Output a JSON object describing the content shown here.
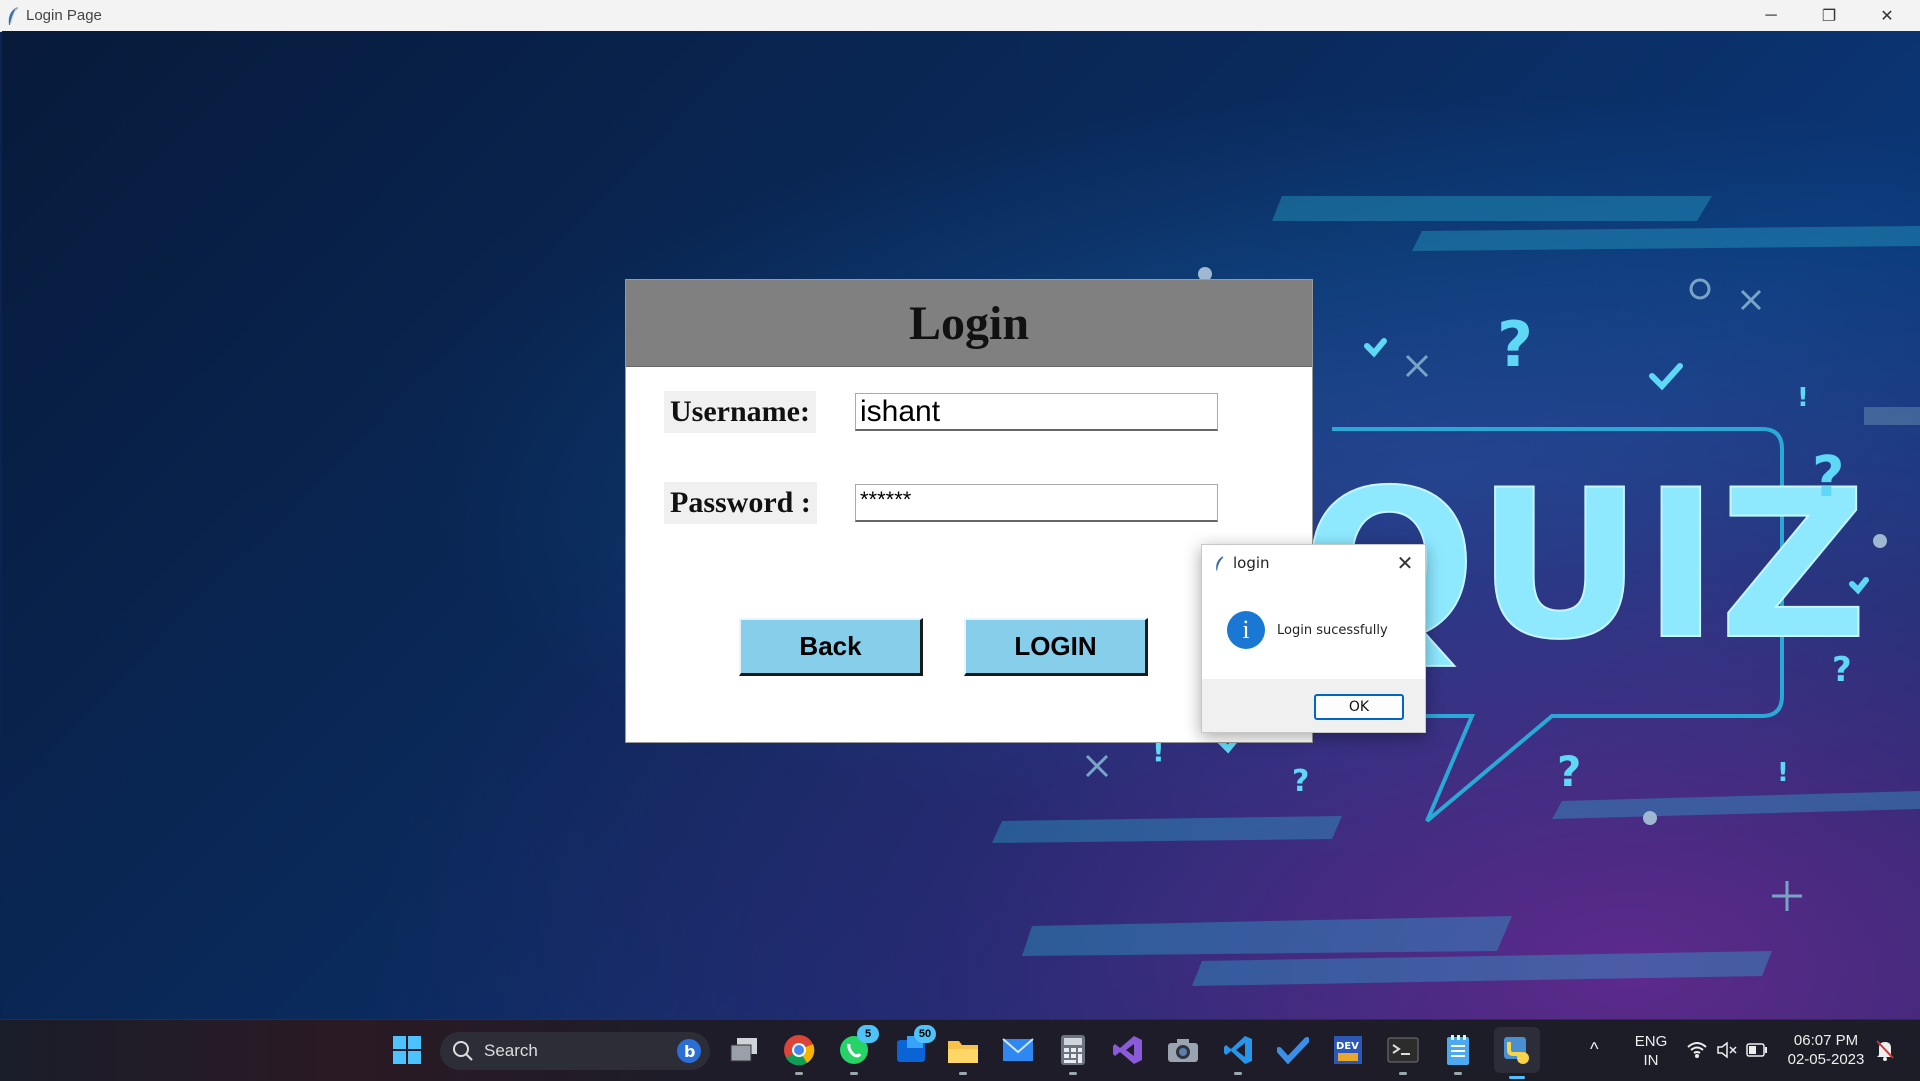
{
  "window": {
    "title": "Login Page",
    "controls": {
      "minimize": "─",
      "restore": "❐",
      "close": "✕"
    }
  },
  "background": {
    "quiz_text": "QUIZ"
  },
  "login": {
    "heading": "Login",
    "username_label": "Username:",
    "username_value": "ishant",
    "password_label": "Password :",
    "password_value": "******",
    "back_label": "Back",
    "login_label": "LOGIN",
    "button_color": "#87ceeb",
    "header_color": "#808080"
  },
  "messagebox": {
    "title": "login",
    "message": "Login sucessfully",
    "ok_label": "OK",
    "close_glyph": "✕",
    "icon_glyph": "i",
    "icon": "info-icon"
  },
  "taskbar": {
    "search_label": "Search",
    "badges": {
      "whatsapp": "5",
      "outlook": "50"
    },
    "apps": [
      "windows-start-icon",
      "search-icon",
      "bing-icon",
      "task-view-icon",
      "chrome-icon",
      "whatsapp-icon",
      "outlook-icon",
      "file-explorer-icon",
      "mail-icon",
      "calculator-icon",
      "visual-studio-icon",
      "camera-icon",
      "vscode-icon",
      "todo-icon",
      "dev-home-icon",
      "terminal-icon",
      "notepad-icon",
      "python-icon"
    ],
    "tray": {
      "chevron": "^",
      "language": "ENG",
      "region": "IN",
      "time": "06:07 PM",
      "date": "02-05-2023"
    }
  }
}
